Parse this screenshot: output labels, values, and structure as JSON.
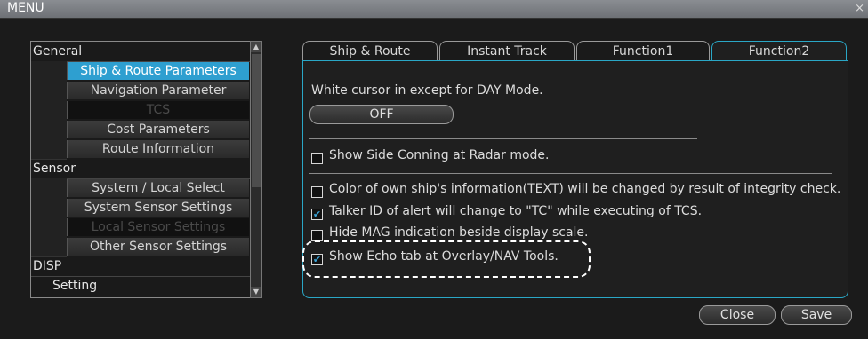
{
  "window": {
    "title": "MENU",
    "close_glyph": "×"
  },
  "tree": {
    "items": [
      {
        "type": "category",
        "label": "General"
      },
      {
        "type": "sub",
        "label": "Ship & Route Parameters",
        "state": "selected"
      },
      {
        "type": "sub",
        "label": "Navigation Parameter",
        "state": "normal"
      },
      {
        "type": "sub",
        "label": "TCS",
        "state": "disabled"
      },
      {
        "type": "sub",
        "label": "Cost Parameters",
        "state": "normal"
      },
      {
        "type": "sub",
        "label": "Route Information",
        "state": "normal"
      },
      {
        "type": "category",
        "label": "Sensor"
      },
      {
        "type": "sub",
        "label": "System / Local Select",
        "state": "normal"
      },
      {
        "type": "sub",
        "label": "System Sensor Settings",
        "state": "normal"
      },
      {
        "type": "sub",
        "label": "Local Sensor Settings",
        "state": "disabled"
      },
      {
        "type": "sub",
        "label": "Other Sensor Settings",
        "state": "normal"
      },
      {
        "type": "category",
        "label": "DISP"
      },
      {
        "type": "category-indent",
        "label": "Setting"
      }
    ]
  },
  "tabs": [
    {
      "label": "Ship & Route",
      "active": false
    },
    {
      "label": "Instant Track",
      "active": false
    },
    {
      "label": "Function1",
      "active": false
    },
    {
      "label": "Function2",
      "active": true
    }
  ],
  "panel": {
    "white_cursor_label": "White cursor in except for DAY Mode.",
    "white_cursor_button": "OFF",
    "options": [
      {
        "label": "Show Side Conning at Radar mode.",
        "checked": false
      },
      {
        "label": "Color of own ship's information(TEXT) will be changed by result of integrity check.",
        "checked": false
      },
      {
        "label": "Talker ID of alert will change to \"TC\" while executing of TCS.",
        "checked": true
      },
      {
        "label": "Hide MAG indication beside display scale.",
        "checked": false
      },
      {
        "label": "Show Echo tab at Overlay/NAV Tools.",
        "checked": true
      }
    ]
  },
  "footer": {
    "close_label": "Close",
    "save_label": "Save"
  },
  "colors": {
    "accent": "#2aa7c6",
    "selected": "#2e9fd0",
    "check": "#3ba3d6"
  }
}
